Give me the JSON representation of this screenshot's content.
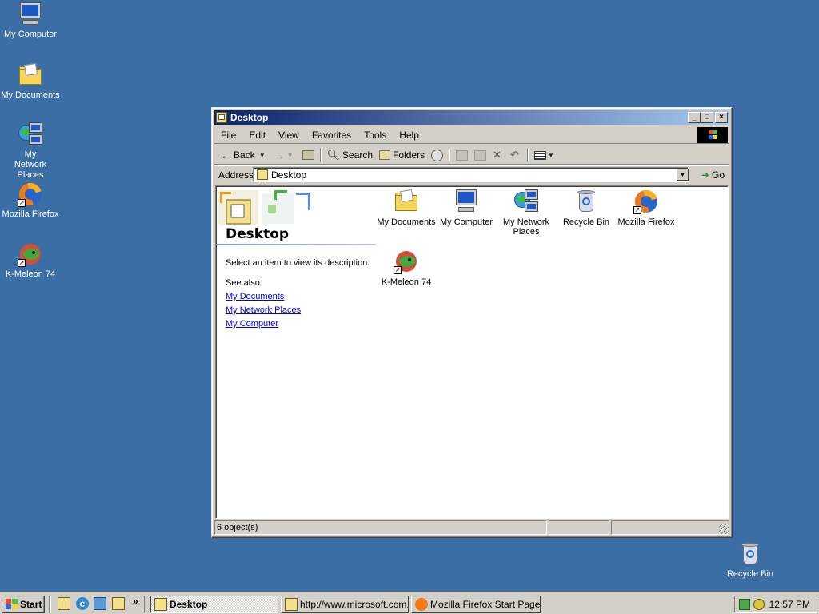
{
  "desktop": {
    "background": "#3a6ea5",
    "icons": [
      {
        "label": "My Computer",
        "icon": "my-computer-icon"
      },
      {
        "label": "My Documents",
        "icon": "my-documents-icon"
      },
      {
        "label": "My Network Places",
        "icon": "network-places-icon"
      },
      {
        "label": "Mozilla Firefox",
        "icon": "firefox-icon"
      },
      {
        "label": "K-Meleon 74",
        "icon": "k-meleon-icon"
      },
      {
        "label": "Recycle Bin",
        "icon": "recycle-bin-icon"
      }
    ]
  },
  "window": {
    "title": "Desktop",
    "controls": {
      "minimize": "_",
      "maximize": "□",
      "close": "×"
    },
    "menu": [
      "File",
      "Edit",
      "View",
      "Favorites",
      "Tools",
      "Help"
    ],
    "toolbar": {
      "back": "Back",
      "back_symbol": "←",
      "forward_symbol": "→",
      "search": "Search",
      "folders": "Folders"
    },
    "address": {
      "label": "Address",
      "value": "Desktop",
      "go": "Go"
    },
    "webview": {
      "title": "Desktop",
      "description": "Select an item to view its description.",
      "see_also": "See also:",
      "links": [
        "My Documents",
        "My Network Places",
        "My Computer"
      ]
    },
    "items": [
      {
        "label": "My Documents",
        "icon": "my-documents-icon"
      },
      {
        "label": "My Computer",
        "icon": "my-computer-icon"
      },
      {
        "label": "My Network Places",
        "icon": "network-places-icon"
      },
      {
        "label": "Recycle Bin",
        "icon": "recycle-bin-icon"
      },
      {
        "label": "Mozilla Firefox",
        "icon": "firefox-icon"
      },
      {
        "label": "K-Meleon 74",
        "icon": "k-meleon-icon"
      }
    ],
    "status": {
      "text": "6 object(s)"
    }
  },
  "taskbar": {
    "start": "Start",
    "more": "»",
    "tasks": [
      {
        "label": "Desktop",
        "active": true
      },
      {
        "label": "http://www.microsoft.com...",
        "active": false
      },
      {
        "label": "Mozilla Firefox Start Page -...",
        "active": false
      }
    ],
    "clock": "12:57 PM"
  }
}
